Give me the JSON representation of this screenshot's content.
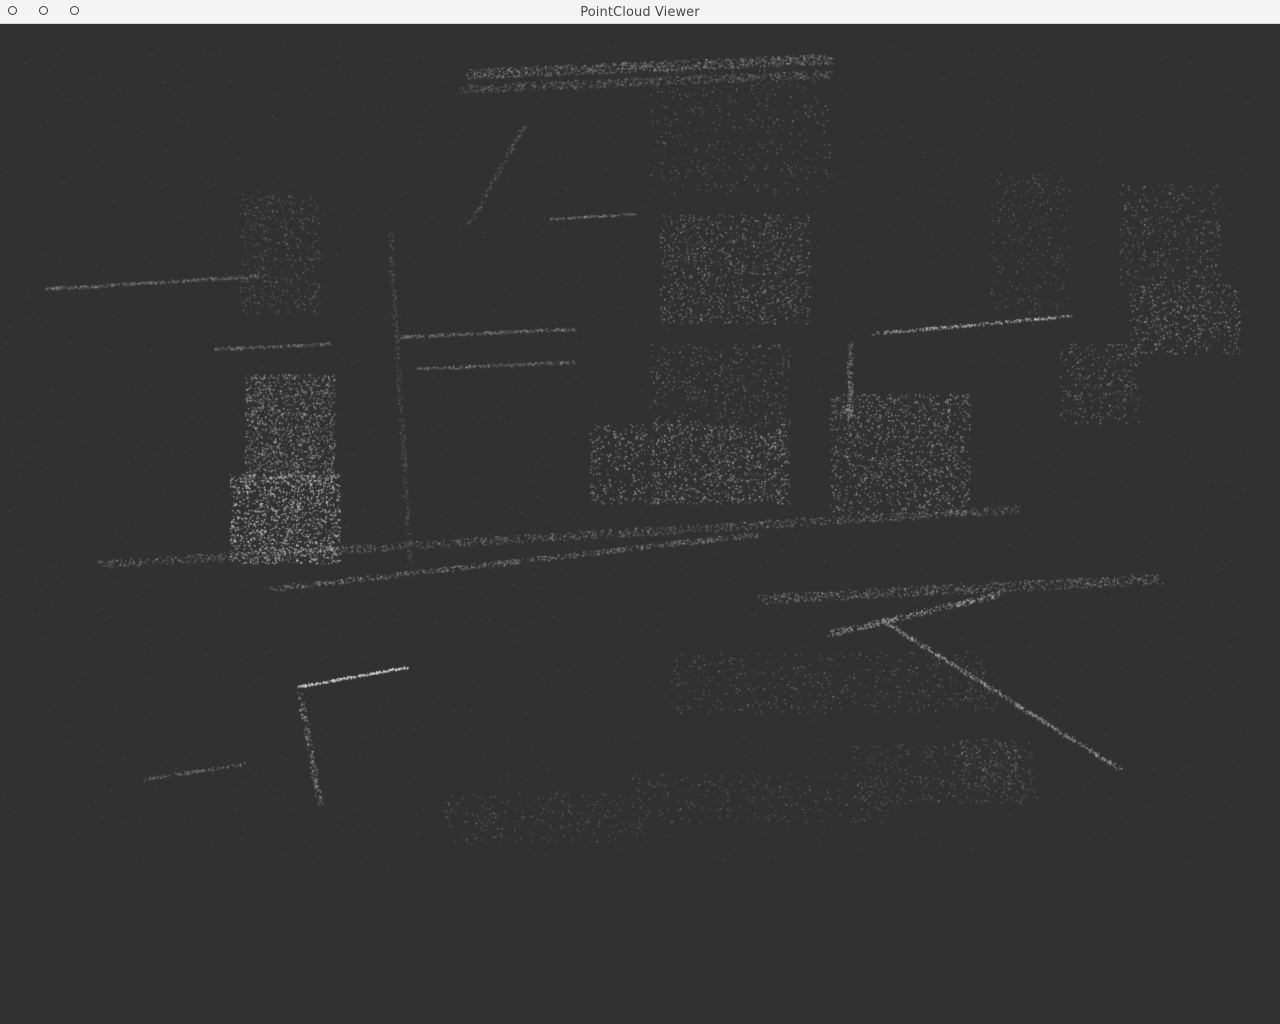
{
  "window": {
    "title": "PointCloud Viewer",
    "controls": {
      "close": "circle-outline",
      "minimize": "circle-outline",
      "maximize": "circle-outline"
    }
  },
  "viewport": {
    "background_color": "#313131",
    "point_color": "#d8d8d8",
    "content": "point-cloud render of a building facade and ground plane"
  }
}
